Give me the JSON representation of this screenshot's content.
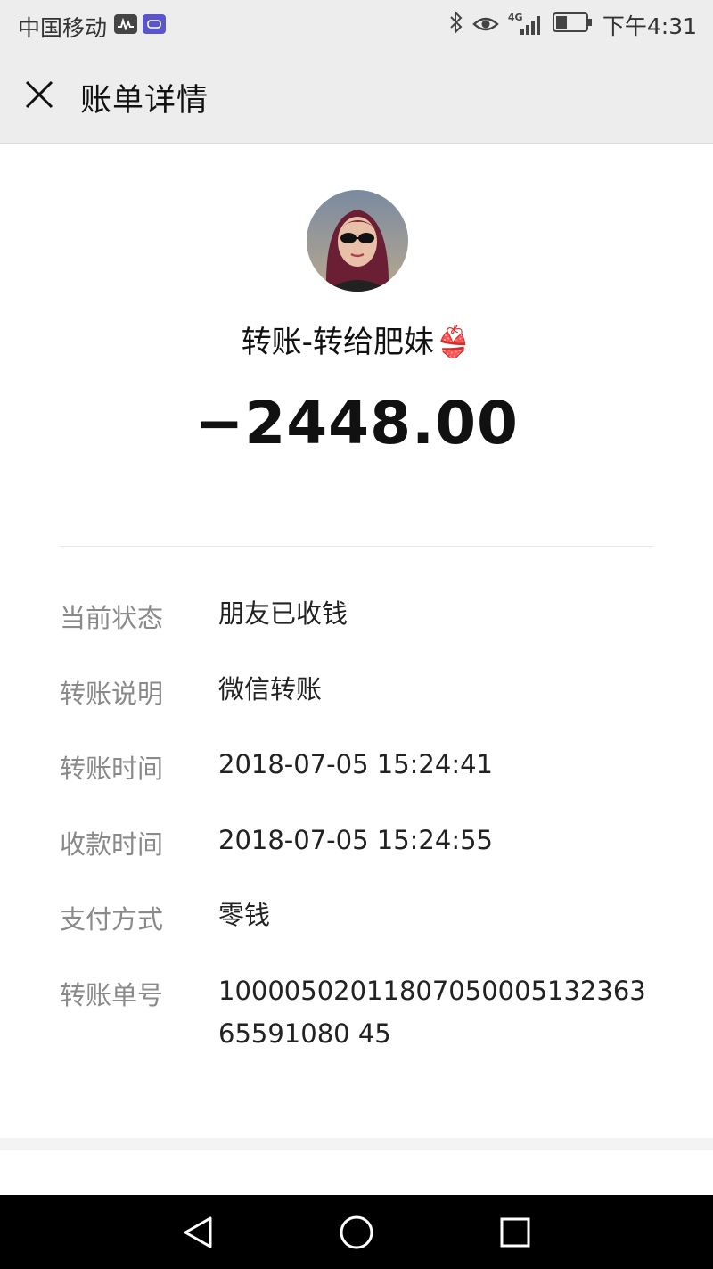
{
  "status_bar": {
    "carrier": "中国移动",
    "network": "4G",
    "time": "下午4:31"
  },
  "header": {
    "title": "账单详情"
  },
  "transaction": {
    "title": "转账-转给肥妹👙",
    "amount": "−2448.00"
  },
  "details": [
    {
      "label": "当前状态",
      "value": "朋友已收钱"
    },
    {
      "label": "转账说明",
      "value": "微信转账"
    },
    {
      "label": "转账时间",
      "value": "2018-07-05 15:24:41"
    },
    {
      "label": "收款时间",
      "value": "2018-07-05 15:24:55"
    },
    {
      "label": "支付方式",
      "value": "零钱"
    },
    {
      "label": "转账单号",
      "value": "1000050201180705000513236365591080 45"
    }
  ],
  "colors": {
    "header_bg": "#ededed",
    "label_gray": "#8a8a8a",
    "nav_bg": "#000000"
  }
}
